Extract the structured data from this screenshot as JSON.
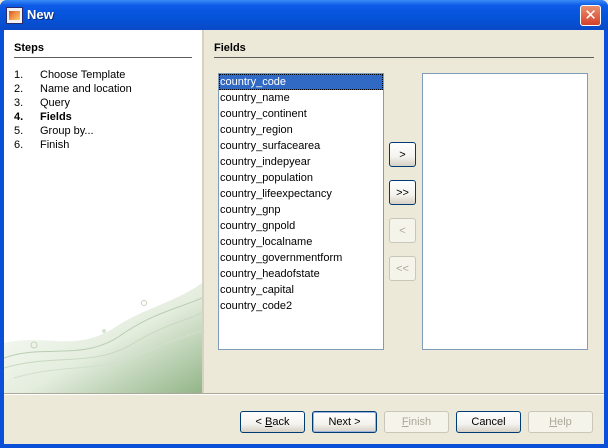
{
  "window": {
    "title": "New",
    "close_label": "✕"
  },
  "steps_panel": {
    "heading": "Steps",
    "items": [
      {
        "num": "1.",
        "label": "Choose Template",
        "current": false
      },
      {
        "num": "2.",
        "label": "Name and location",
        "current": false
      },
      {
        "num": "3.",
        "label": "Query",
        "current": false
      },
      {
        "num": "4.",
        "label": "Fields",
        "current": true
      },
      {
        "num": "5.",
        "label": "Group by...",
        "current": false
      },
      {
        "num": "6.",
        "label": "Finish",
        "current": false
      }
    ]
  },
  "fields_panel": {
    "heading": "Fields",
    "available_fields": [
      "country_code",
      "country_name",
      "country_continent",
      "country_region",
      "country_surfacearea",
      "country_indepyear",
      "country_population",
      "country_lifeexpectancy",
      "country_gnp",
      "country_gnpold",
      "country_localname",
      "country_governmentform",
      "country_headofstate",
      "country_capital",
      "country_code2"
    ],
    "selected_index": 0,
    "chosen_fields": [],
    "move_buttons": {
      "add_one": ">",
      "add_all": ">>",
      "remove_one": "<",
      "remove_all": "<<"
    }
  },
  "footer": {
    "back": {
      "pre": "< ",
      "mnemonic": "B",
      "post": "ack"
    },
    "next": "Next >",
    "finish": {
      "pre": "",
      "mnemonic": "F",
      "post": "inish"
    },
    "cancel": "Cancel",
    "help": {
      "pre": "",
      "mnemonic": "H",
      "post": "elp"
    }
  },
  "colors": {
    "titlebar": "#0553d9",
    "selection": "#316ac5",
    "dialog_bg": "#ece9d8"
  }
}
